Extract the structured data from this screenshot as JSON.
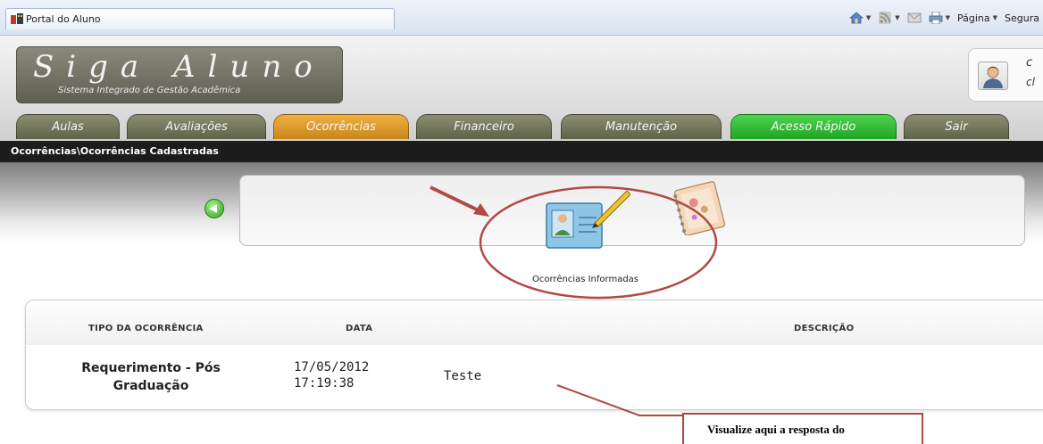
{
  "browser": {
    "tab_title": "Portal do Aluno",
    "tools": {
      "page_label": "Página",
      "safety_label": "Segura"
    }
  },
  "header": {
    "logo_title": "Siga Aluno",
    "logo_subtitle": "Sistema Integrado de Gestão Acadêmica",
    "user_line1": "c",
    "user_line2": "cl"
  },
  "nav": {
    "tabs": [
      {
        "label": "Aulas",
        "color": "#7b7e61"
      },
      {
        "label": "Avaliações",
        "color": "#7b7e61"
      },
      {
        "label": "Ocorrências",
        "color": "#e2a032"
      },
      {
        "label": "Financeiro",
        "color": "#7b7e61"
      },
      {
        "label": "Manutenção",
        "color": "#7b7e61"
      },
      {
        "label": "Acesso Rápido",
        "color": "#37c03a"
      },
      {
        "label": "Sair",
        "color": "#7b7e61"
      }
    ],
    "active_tab": "Ocorrências"
  },
  "breadcrumb": "Ocorrências\\Ocorrências Cadastradas",
  "actions": {
    "informed_label": "Ocorrências Informadas"
  },
  "table": {
    "columns": [
      "TIPO DA OCORRÊNCIA",
      "DATA",
      "DESCRIÇÃO"
    ],
    "rows": [
      {
        "tipo_line1": "Requerimento - Pós",
        "tipo_line2": "Graduação",
        "data_line1": "17/05/2012",
        "data_line2": "17:19:38",
        "descricao": "Teste"
      }
    ]
  },
  "annotation": {
    "callout_text": "Visualize aqui a resposta do",
    "annotation_color": "#b04a45"
  }
}
